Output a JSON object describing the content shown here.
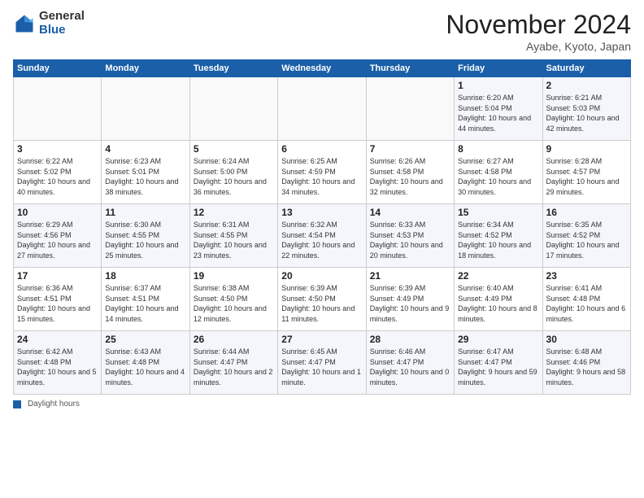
{
  "logo": {
    "general": "General",
    "blue": "Blue"
  },
  "title": "November 2024",
  "location": "Ayabe, Kyoto, Japan",
  "days_of_week": [
    "Sunday",
    "Monday",
    "Tuesday",
    "Wednesday",
    "Thursday",
    "Friday",
    "Saturday"
  ],
  "legend_label": "Daylight hours",
  "weeks": [
    [
      {
        "day": "",
        "empty": true
      },
      {
        "day": "",
        "empty": true
      },
      {
        "day": "",
        "empty": true
      },
      {
        "day": "",
        "empty": true
      },
      {
        "day": "",
        "empty": true
      },
      {
        "day": "1",
        "sunrise": "Sunrise: 6:20 AM",
        "sunset": "Sunset: 5:04 PM",
        "daylight": "Daylight: 10 hours and 44 minutes."
      },
      {
        "day": "2",
        "sunrise": "Sunrise: 6:21 AM",
        "sunset": "Sunset: 5:03 PM",
        "daylight": "Daylight: 10 hours and 42 minutes."
      }
    ],
    [
      {
        "day": "3",
        "sunrise": "Sunrise: 6:22 AM",
        "sunset": "Sunset: 5:02 PM",
        "daylight": "Daylight: 10 hours and 40 minutes."
      },
      {
        "day": "4",
        "sunrise": "Sunrise: 6:23 AM",
        "sunset": "Sunset: 5:01 PM",
        "daylight": "Daylight: 10 hours and 38 minutes."
      },
      {
        "day": "5",
        "sunrise": "Sunrise: 6:24 AM",
        "sunset": "Sunset: 5:00 PM",
        "daylight": "Daylight: 10 hours and 36 minutes."
      },
      {
        "day": "6",
        "sunrise": "Sunrise: 6:25 AM",
        "sunset": "Sunset: 4:59 PM",
        "daylight": "Daylight: 10 hours and 34 minutes."
      },
      {
        "day": "7",
        "sunrise": "Sunrise: 6:26 AM",
        "sunset": "Sunset: 4:58 PM",
        "daylight": "Daylight: 10 hours and 32 minutes."
      },
      {
        "day": "8",
        "sunrise": "Sunrise: 6:27 AM",
        "sunset": "Sunset: 4:58 PM",
        "daylight": "Daylight: 10 hours and 30 minutes."
      },
      {
        "day": "9",
        "sunrise": "Sunrise: 6:28 AM",
        "sunset": "Sunset: 4:57 PM",
        "daylight": "Daylight: 10 hours and 29 minutes."
      }
    ],
    [
      {
        "day": "10",
        "sunrise": "Sunrise: 6:29 AM",
        "sunset": "Sunset: 4:56 PM",
        "daylight": "Daylight: 10 hours and 27 minutes."
      },
      {
        "day": "11",
        "sunrise": "Sunrise: 6:30 AM",
        "sunset": "Sunset: 4:55 PM",
        "daylight": "Daylight: 10 hours and 25 minutes."
      },
      {
        "day": "12",
        "sunrise": "Sunrise: 6:31 AM",
        "sunset": "Sunset: 4:55 PM",
        "daylight": "Daylight: 10 hours and 23 minutes."
      },
      {
        "day": "13",
        "sunrise": "Sunrise: 6:32 AM",
        "sunset": "Sunset: 4:54 PM",
        "daylight": "Daylight: 10 hours and 22 minutes."
      },
      {
        "day": "14",
        "sunrise": "Sunrise: 6:33 AM",
        "sunset": "Sunset: 4:53 PM",
        "daylight": "Daylight: 10 hours and 20 minutes."
      },
      {
        "day": "15",
        "sunrise": "Sunrise: 6:34 AM",
        "sunset": "Sunset: 4:52 PM",
        "daylight": "Daylight: 10 hours and 18 minutes."
      },
      {
        "day": "16",
        "sunrise": "Sunrise: 6:35 AM",
        "sunset": "Sunset: 4:52 PM",
        "daylight": "Daylight: 10 hours and 17 minutes."
      }
    ],
    [
      {
        "day": "17",
        "sunrise": "Sunrise: 6:36 AM",
        "sunset": "Sunset: 4:51 PM",
        "daylight": "Daylight: 10 hours and 15 minutes."
      },
      {
        "day": "18",
        "sunrise": "Sunrise: 6:37 AM",
        "sunset": "Sunset: 4:51 PM",
        "daylight": "Daylight: 10 hours and 14 minutes."
      },
      {
        "day": "19",
        "sunrise": "Sunrise: 6:38 AM",
        "sunset": "Sunset: 4:50 PM",
        "daylight": "Daylight: 10 hours and 12 minutes."
      },
      {
        "day": "20",
        "sunrise": "Sunrise: 6:39 AM",
        "sunset": "Sunset: 4:50 PM",
        "daylight": "Daylight: 10 hours and 11 minutes."
      },
      {
        "day": "21",
        "sunrise": "Sunrise: 6:39 AM",
        "sunset": "Sunset: 4:49 PM",
        "daylight": "Daylight: 10 hours and 9 minutes."
      },
      {
        "day": "22",
        "sunrise": "Sunrise: 6:40 AM",
        "sunset": "Sunset: 4:49 PM",
        "daylight": "Daylight: 10 hours and 8 minutes."
      },
      {
        "day": "23",
        "sunrise": "Sunrise: 6:41 AM",
        "sunset": "Sunset: 4:48 PM",
        "daylight": "Daylight: 10 hours and 6 minutes."
      }
    ],
    [
      {
        "day": "24",
        "sunrise": "Sunrise: 6:42 AM",
        "sunset": "Sunset: 4:48 PM",
        "daylight": "Daylight: 10 hours and 5 minutes."
      },
      {
        "day": "25",
        "sunrise": "Sunrise: 6:43 AM",
        "sunset": "Sunset: 4:48 PM",
        "daylight": "Daylight: 10 hours and 4 minutes."
      },
      {
        "day": "26",
        "sunrise": "Sunrise: 6:44 AM",
        "sunset": "Sunset: 4:47 PM",
        "daylight": "Daylight: 10 hours and 2 minutes."
      },
      {
        "day": "27",
        "sunrise": "Sunrise: 6:45 AM",
        "sunset": "Sunset: 4:47 PM",
        "daylight": "Daylight: 10 hours and 1 minute."
      },
      {
        "day": "28",
        "sunrise": "Sunrise: 6:46 AM",
        "sunset": "Sunset: 4:47 PM",
        "daylight": "Daylight: 10 hours and 0 minutes."
      },
      {
        "day": "29",
        "sunrise": "Sunrise: 6:47 AM",
        "sunset": "Sunset: 4:47 PM",
        "daylight": "Daylight: 9 hours and 59 minutes."
      },
      {
        "day": "30",
        "sunrise": "Sunrise: 6:48 AM",
        "sunset": "Sunset: 4:46 PM",
        "daylight": "Daylight: 9 hours and 58 minutes."
      }
    ]
  ]
}
